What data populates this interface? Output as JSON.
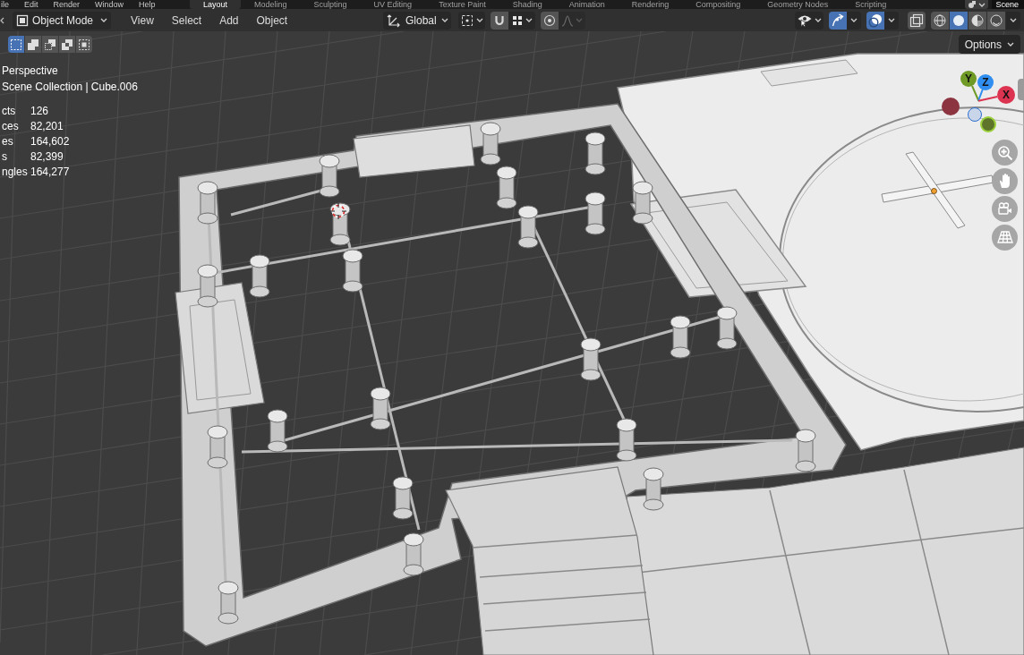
{
  "topbar": {
    "menus": [
      "ile",
      "Edit",
      "Render",
      "Window",
      "Help"
    ],
    "workspaces": [
      {
        "label": "Layout",
        "selected": true
      },
      {
        "label": "Modeling",
        "selected": false
      },
      {
        "label": "Sculpting",
        "selected": false
      },
      {
        "label": "UV Editing",
        "selected": false
      },
      {
        "label": "Texture Paint",
        "selected": false
      },
      {
        "label": "Shading",
        "selected": false
      },
      {
        "label": "Animation",
        "selected": false
      },
      {
        "label": "Rendering",
        "selected": false
      },
      {
        "label": "Compositing",
        "selected": false
      },
      {
        "label": "Geometry Nodes",
        "selected": false
      },
      {
        "label": "Scripting",
        "selected": false
      }
    ],
    "scene": "Scene"
  },
  "header": {
    "mode": "Object Mode",
    "menus": [
      "View",
      "Select",
      "Add",
      "Object"
    ],
    "orientation": "Global",
    "snapping": {
      "on": false
    },
    "proportional_editing": {
      "on": false
    },
    "gizmos": {
      "on": true
    },
    "overlays": {
      "on": true
    },
    "xray": {
      "on": false
    },
    "shading": [
      {
        "selected": false
      },
      {
        "selected": true
      },
      {
        "selected": false
      },
      {
        "selected": false
      }
    ]
  },
  "select_modes": [
    {
      "selected": true
    },
    {
      "selected": false
    },
    {
      "selected": false
    },
    {
      "selected": false
    },
    {
      "selected": false
    }
  ],
  "options": "Options",
  "viewport_info": {
    "view": "Perspective",
    "collection": "Scene Collection | Cube.006",
    "stats": [
      {
        "label": "cts",
        "value": "126"
      },
      {
        "label": "ces",
        "value": "82,201"
      },
      {
        "label": "es",
        "value": "164,602"
      },
      {
        "label": "s",
        "value": "82,399"
      },
      {
        "label": "ngles",
        "value": "164,277"
      }
    ]
  },
  "gizmo": {
    "axes": [
      {
        "kind": "negative",
        "color": "#8c3440"
      },
      {
        "kind": "negative",
        "color": "#c9d6ea"
      },
      {
        "kind": "negative",
        "color": "#5e742a"
      },
      {
        "kind": "positive",
        "label": "Y",
        "color": "#6f9a26"
      },
      {
        "kind": "positive",
        "label": "Z",
        "color": "#2f8ef0"
      },
      {
        "kind": "positive",
        "label": "X",
        "color": "#dc3450"
      }
    ]
  }
}
